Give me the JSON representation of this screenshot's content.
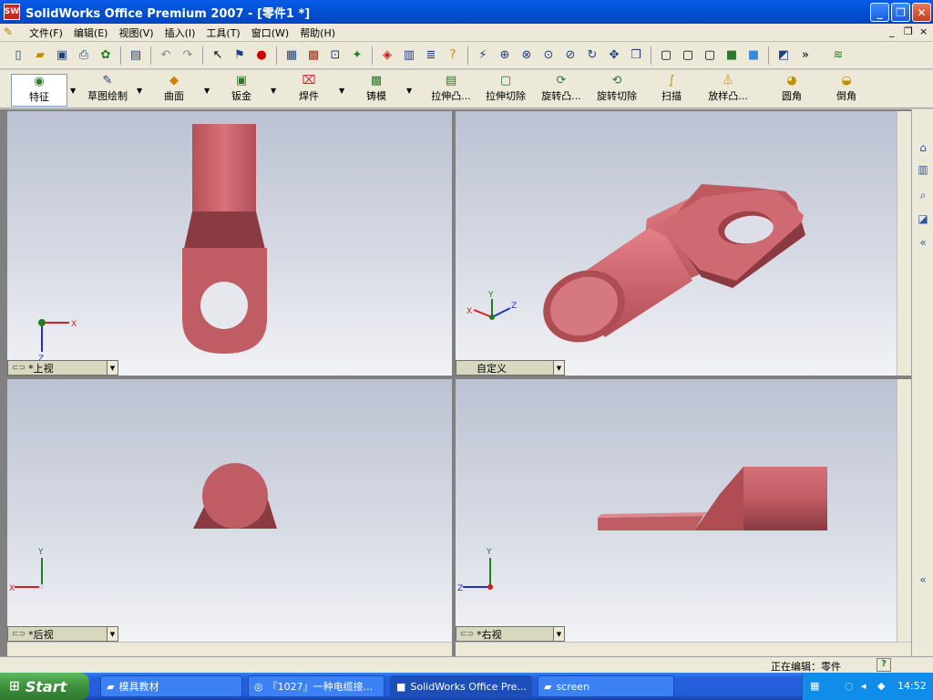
{
  "window": {
    "logo": "SW",
    "title": "SolidWorks Office Premium 2007 - [零件1 *]",
    "controls": {
      "minimize": "_",
      "maximize": "❐",
      "close": "✕"
    }
  },
  "menubar": {
    "items": [
      "文件(F)",
      "编辑(E)",
      "视图(V)",
      "插入(I)",
      "工具(T)",
      "窗口(W)",
      "帮助(H)"
    ],
    "mdi_controls": {
      "minimize": "_",
      "restore": "❐",
      "close": "×"
    }
  },
  "toolbar_standard": {
    "icons": [
      "new-doc-icon",
      "open-icon",
      "save-icon",
      "print-icon",
      "options-icon",
      "undo-icon",
      "redo-icon",
      "select-icon",
      "rebuild-icon",
      "traffic-light-icon",
      "grid-icon",
      "brick-icon",
      "sketch-icon",
      "display-icon",
      "zoom-fit-icon",
      "zoom-area-icon",
      "zoom-inout-icon",
      "zoom-selection-icon",
      "rotate-icon",
      "pan-icon",
      "view-orientation-icon",
      "wireframe-icon",
      "hidden-lines-icon",
      "shaded-icon",
      "section-icon"
    ]
  },
  "toolbar_features": {
    "buttons": [
      {
        "label": "特征",
        "icon": "features-icon"
      },
      {
        "label": "草图绘制",
        "icon": "sketch-icon"
      },
      {
        "label": "曲面",
        "icon": "surface-icon"
      },
      {
        "label": "钣金",
        "icon": "sheet-metal-icon"
      },
      {
        "label": "焊件",
        "icon": "weldment-icon"
      },
      {
        "label": "铸模",
        "icon": "mold-icon"
      },
      {
        "label": "拉伸凸...",
        "icon": "extrude-boss-icon"
      },
      {
        "label": "拉伸切除",
        "icon": "extrude-cut-icon"
      },
      {
        "label": "旋转凸...",
        "icon": "revolve-boss-icon"
      },
      {
        "label": "旋转切除",
        "icon": "revolve-cut-icon"
      },
      {
        "label": "扫描",
        "icon": "sweep-icon"
      },
      {
        "label": "放样凸...",
        "icon": "loft-boss-icon"
      },
      {
        "label": "圆角",
        "icon": "fillet-icon"
      },
      {
        "label": "倒角",
        "icon": "chamfer-icon"
      }
    ]
  },
  "viewports": {
    "top": {
      "label": "*上视",
      "axes": {
        "a": "X",
        "b": "Z"
      }
    },
    "iso": {
      "label": "自定义",
      "axes": {
        "a": "Y",
        "b": "Z",
        "c": "X"
      }
    },
    "back": {
      "label": "*后视",
      "axes": {
        "a": "Y",
        "b": "X"
      }
    },
    "right": {
      "label": "*右视",
      "axes": {
        "a": "Y",
        "b": "Z"
      }
    }
  },
  "taskpane": {
    "icons": [
      "home-icon",
      "library-icon",
      "search-icon",
      "appearance-icon",
      "collapse-icon"
    ]
  },
  "statusbar": {
    "text": "正在编辑：零件",
    "help": "?"
  },
  "taskbar": {
    "start_label": "Start",
    "tasks": [
      {
        "label": "模具教材",
        "icon": "folder-icon"
      },
      {
        "label": "『1027』一种电缆接...",
        "icon": "browser-icon"
      },
      {
        "label": "SolidWorks Office Pre...",
        "icon": "solidworks-icon"
      },
      {
        "label": "screen",
        "icon": "folder-icon"
      }
    ],
    "clock": "14:52"
  },
  "colors": {
    "part": "#c8606a",
    "part_dark": "#8a3a40",
    "titlebar": "#0052d6",
    "taskbar": "#245edb"
  }
}
